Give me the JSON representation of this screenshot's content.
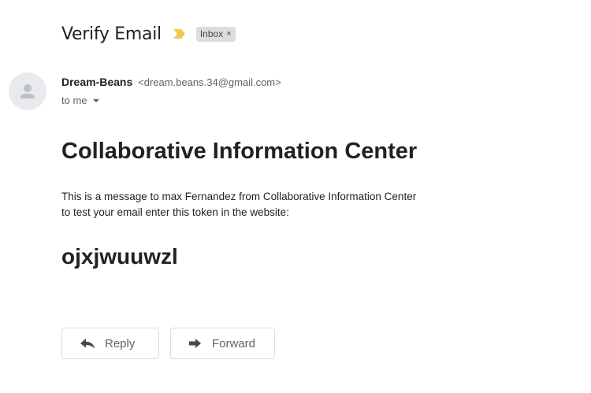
{
  "email": {
    "subject": "Verify Email",
    "label": "Inbox",
    "label_remove_glyph": "×",
    "sender_name": "Dream-Beans",
    "sender_email": "<dream.beans.34@gmail.com>",
    "recipient": "to me",
    "body_heading": "Collaborative Information Center",
    "body_lines": [
      "This is a message to max Fernandez from Collaborative Information Center",
      "to test your email enter this token in the website:"
    ],
    "token": "ojxjwuuwzl"
  },
  "actions": {
    "reply_label": "Reply",
    "forward_label": "Forward"
  },
  "icons": {
    "importance": "importance-marker-icon",
    "avatar": "person-icon",
    "reply": "reply-arrow-icon",
    "forward": "forward-arrow-icon",
    "recipient_details": "chevron-down-icon"
  },
  "colors": {
    "importance_marker": "#f2c94c",
    "label_chip_bg": "#dddddd",
    "muted_text": "#5f6368"
  }
}
